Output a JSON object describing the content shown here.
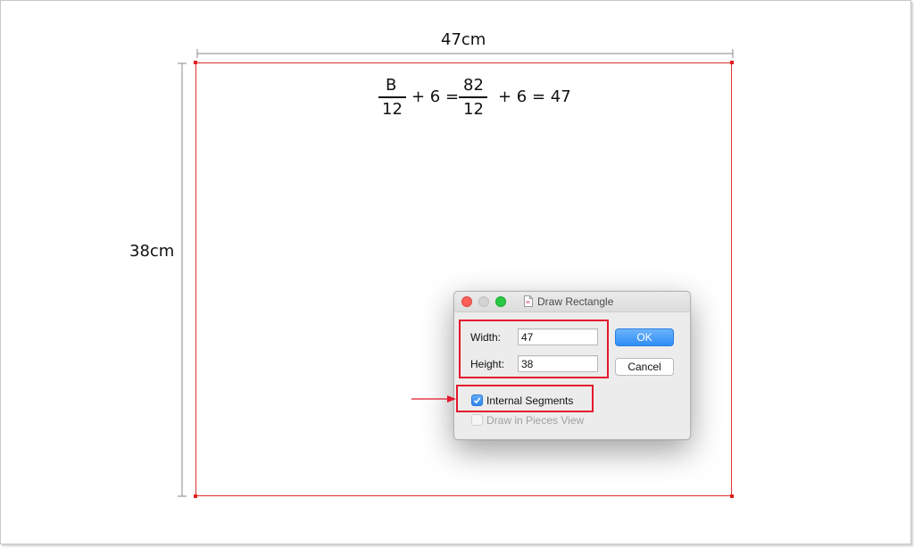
{
  "dimensions": {
    "width_label": "47cm",
    "height_label": "38cm"
  },
  "formula": {
    "numerator1": "B",
    "denominator1": "12",
    "middle": "+ 6 =",
    "numerator2": "82",
    "denominator2": "12",
    "tail": "+ 6 = 47"
  },
  "dialog": {
    "title": "Draw Rectangle",
    "width_label": "Width:",
    "width_value": "47",
    "height_label": "Height:",
    "height_value": "38",
    "ok_label": "OK",
    "cancel_label": "Cancel",
    "internal_segments_label": "Internal Segments",
    "internal_segments_checked": true,
    "pieces_view_label": "Draw in Pieces View",
    "pieces_view_checked": false
  },
  "colors": {
    "highlight": "#e3172d",
    "rectangle_outline": "#e03030",
    "ok_button": "#2d8ef5",
    "traffic_close": "#fc5f57",
    "traffic_minimize": "#cfcfcf",
    "traffic_zoom": "#28c840"
  },
  "icons": [
    "document-icon",
    "checkmark-icon",
    "arrow-icon"
  ]
}
